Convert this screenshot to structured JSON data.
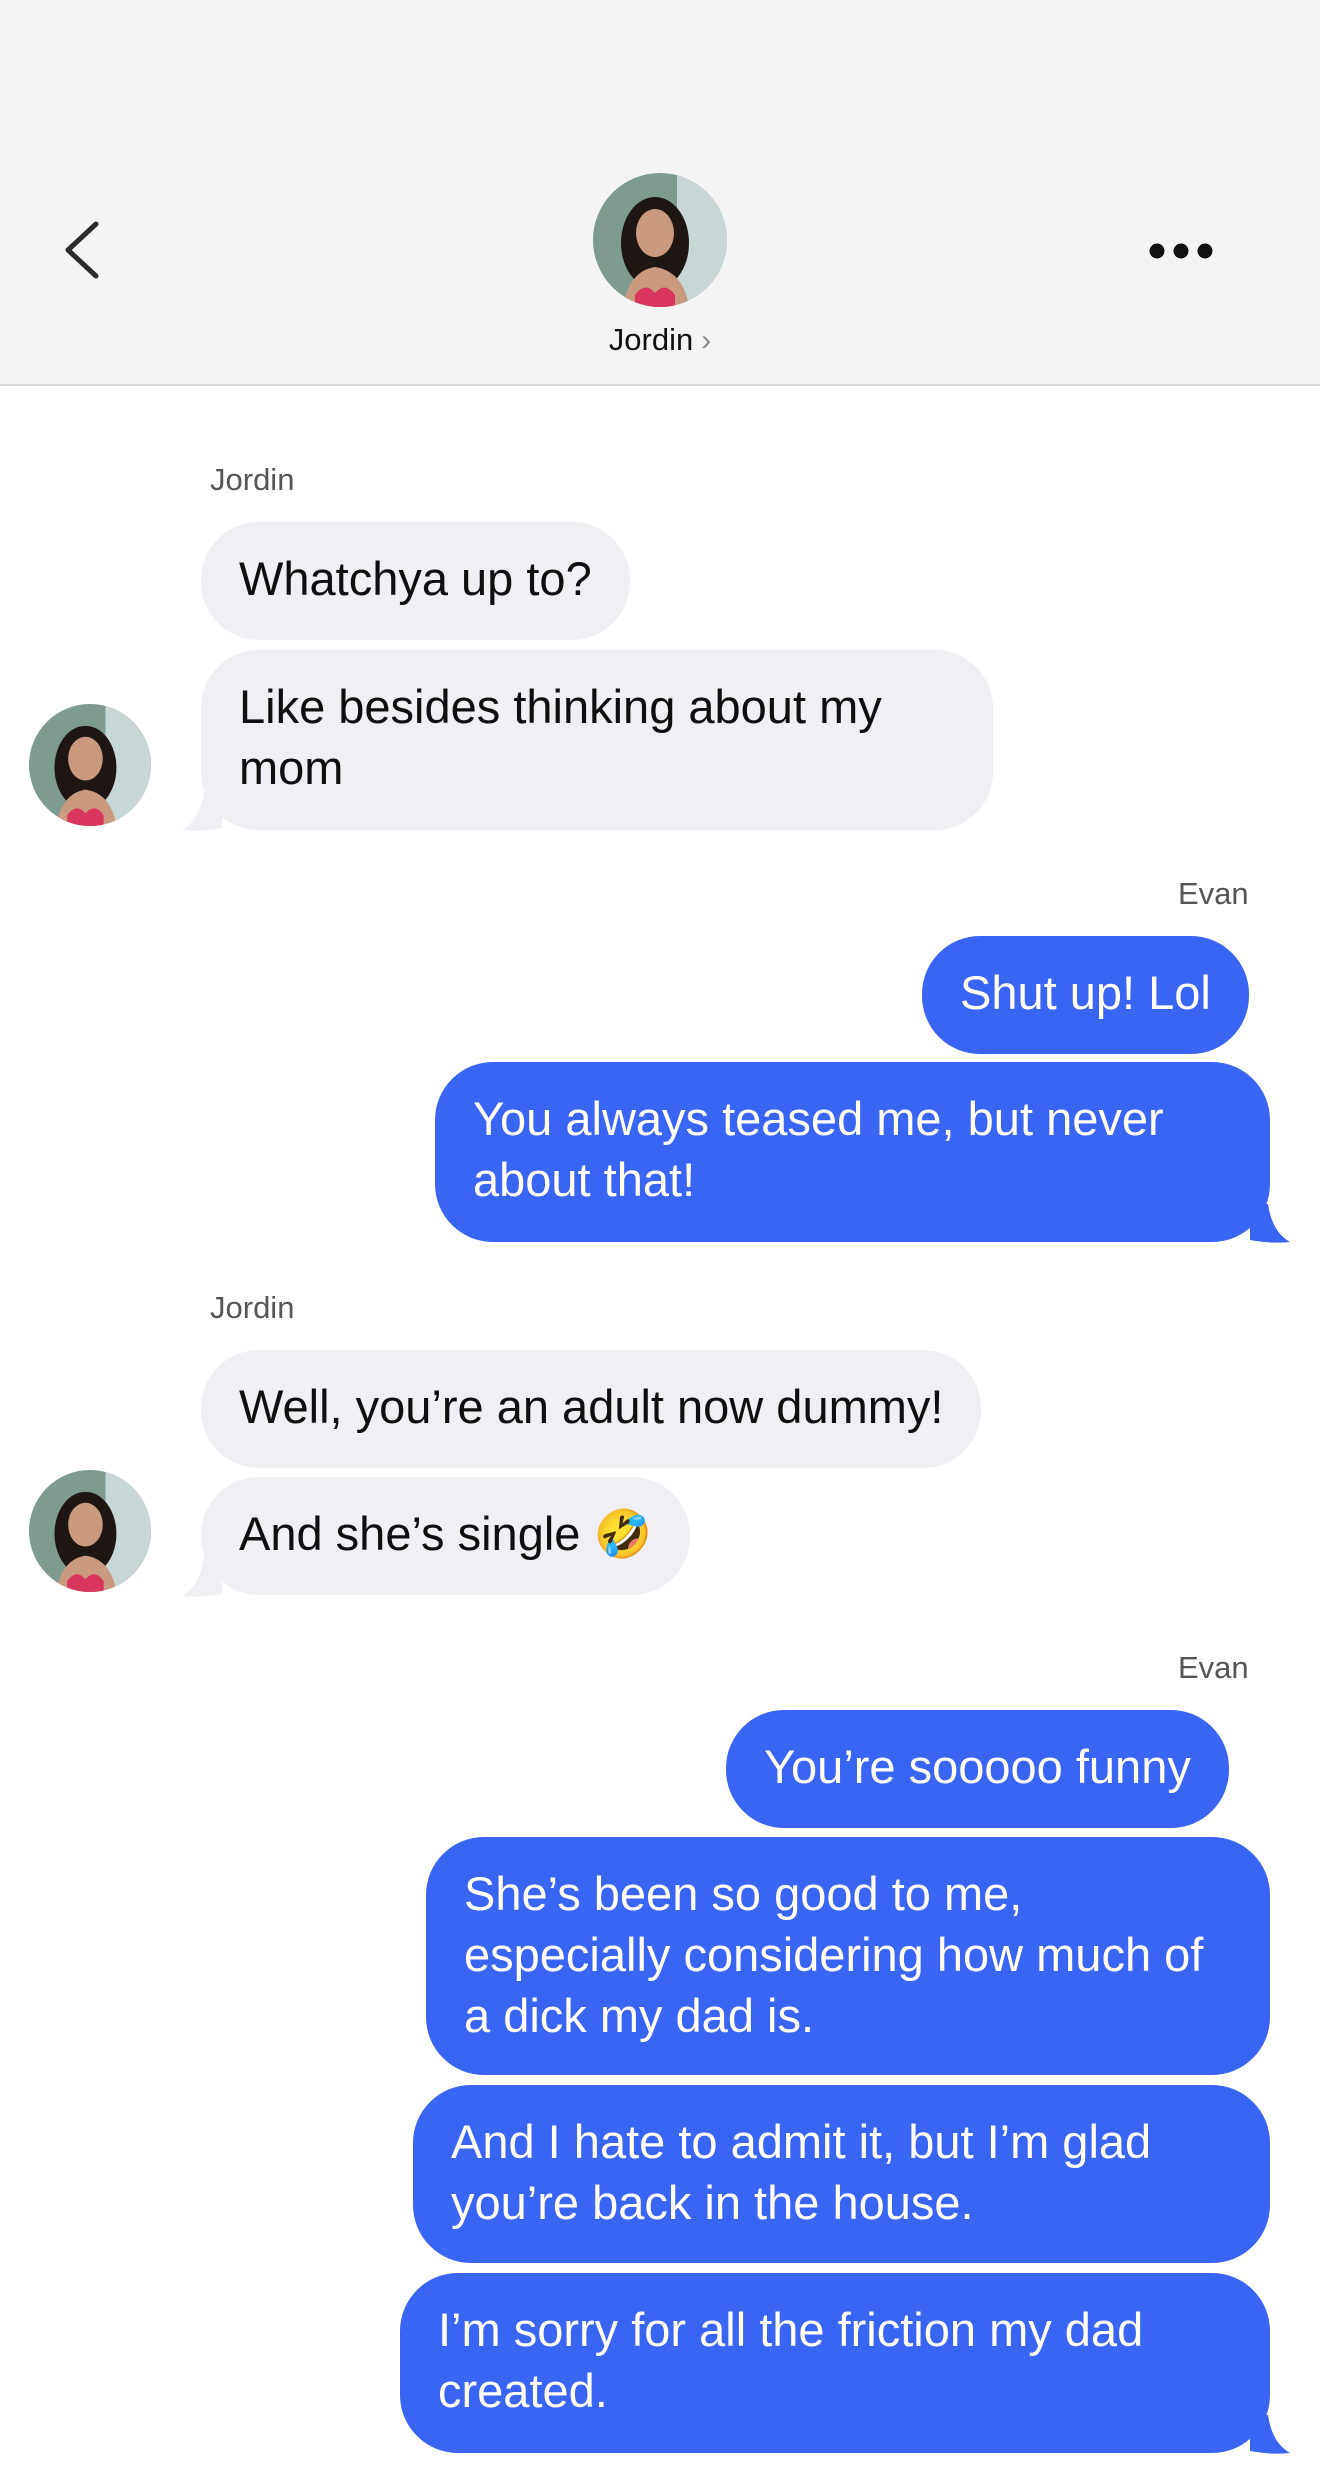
{
  "header": {
    "contact_name": "Jordin",
    "chevron": "›"
  },
  "colors": {
    "incoming_bubble": "#efeff4",
    "outgoing_bubble": "#3a64f2",
    "header_bg": "#f4f4f4"
  },
  "icons": {
    "back": "back-chevron-icon",
    "more": "more-dots-icon"
  },
  "messages": [
    {
      "sender": "Jordin",
      "text": "Whatchya up to?"
    },
    {
      "sender": "Jordin",
      "text": "Like besides thinking about my mom"
    },
    {
      "sender": "Evan",
      "text": "Shut up! Lol"
    },
    {
      "sender": "Evan",
      "text": "You always teased me, but never about that!"
    },
    {
      "sender": "Jordin",
      "text": "Well, you’re an adult now dummy!"
    },
    {
      "sender": "Jordin",
      "text": "And she’s single 🤣"
    },
    {
      "sender": "Evan",
      "text": "You’re sooooo funny"
    },
    {
      "sender": "Evan",
      "text": "She’s been so good to me, especially considering how much of a dick my dad is."
    },
    {
      "sender": "Evan",
      "text": "And I hate to admit it, but I’m glad you’re back in the house."
    },
    {
      "sender": "Evan",
      "text": "I’m sorry for all the friction my dad created."
    }
  ]
}
